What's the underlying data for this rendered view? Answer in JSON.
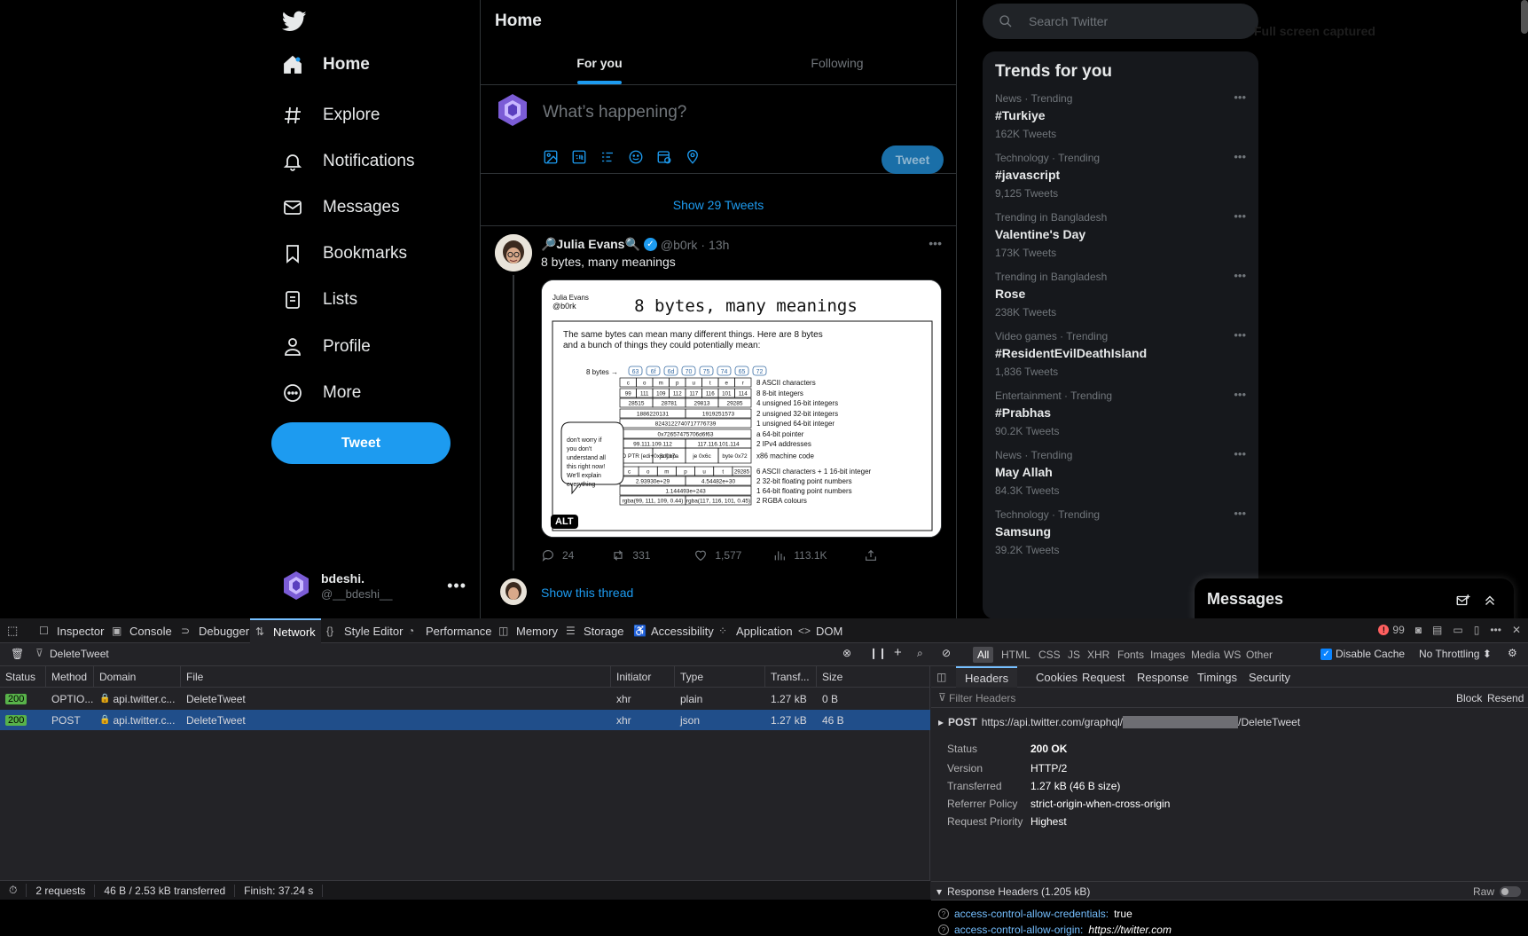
{
  "twitter": {
    "nav": {
      "items": [
        {
          "label": "Home",
          "icon": "home-icon",
          "active": true
        },
        {
          "label": "Explore",
          "icon": "hashtag-icon"
        },
        {
          "label": "Notifications",
          "icon": "bell-icon"
        },
        {
          "label": "Messages",
          "icon": "envelope-icon"
        },
        {
          "label": "Bookmarks",
          "icon": "bookmark-icon"
        },
        {
          "label": "Lists",
          "icon": "list-icon"
        },
        {
          "label": "Profile",
          "icon": "person-icon"
        },
        {
          "label": "More",
          "icon": "more-circle-icon"
        }
      ],
      "tweet_button": "Tweet",
      "account": {
        "display_name": "bdeshi.",
        "handle": "@__bdeshi__"
      }
    },
    "center": {
      "title": "Home",
      "tabs": [
        {
          "label": "For you",
          "active": true
        },
        {
          "label": "Following",
          "active": false
        }
      ],
      "composer": {
        "placeholder": "What’s happening?",
        "tweet_button": "Tweet"
      },
      "show_more": "Show 29 Tweets",
      "post": {
        "author": "🔎Julia Evans🔍",
        "handle": "@b0rk",
        "time": "13h",
        "text": "8 bytes, many meanings",
        "media_alt_badge": "ALT",
        "media": {
          "signature": "Julia Evans @b0rk",
          "title": "8 bytes, many meanings",
          "intro": "The same bytes can mean many different things. Here are 8 bytes and a bunch of things they could potentially mean:",
          "bytes_label": "8 bytes",
          "hex": [
            "63",
            "6f",
            "6d",
            "70",
            "75",
            "74",
            "65",
            "72"
          ],
          "bubble": "don't worry if you don't understand all this right now! We'll explain everything",
          "rows": [
            {
              "cells": [
                "c",
                "o",
                "m",
                "p",
                "u",
                "t",
                "e",
                "r"
              ],
              "desc": "8 ASCII characters"
            },
            {
              "cells": [
                "99",
                "111",
                "109",
                "112",
                "117",
                "116",
                "101",
                "114"
              ],
              "desc": "8 8-bit integers"
            },
            {
              "cells": [
                "28515",
                "28781",
                "29813",
                "29285"
              ],
              "desc": "4 unsigned 16-bit integers"
            },
            {
              "cells": [
                "1886220131",
                "1919251573"
              ],
              "desc": "2 unsigned 32-bit integers"
            },
            {
              "cells": [
                "8243122740717776739"
              ],
              "desc": "1 unsigned 64-bit integer"
            },
            {
              "cells": [
                "0x72657475706d6f63"
              ],
              "desc": "a 64-bit pointer"
            },
            {
              "cells": [
                "99.111.109.112",
                "117.116.101.114"
              ],
              "desc": "2 IPv4 addresses"
            },
            {
              "cells": [
                "arpl WORD PTR [edi+0x6d],bp",
                "jo 0x7a",
                "je 0x6c",
                "byte 0x72"
              ],
              "desc": "x86 machine code"
            },
            {
              "cells": [
                "c",
                "o",
                "m",
                "p",
                "u",
                "t",
                "29285"
              ],
              "desc": "6 ASCII characters + 1 16-bit integer"
            },
            {
              "cells": [
                "2.93930e+29",
                "4.54482e+30"
              ],
              "desc": "2 32-bit floating point numbers"
            },
            {
              "cells": [
                "1.144493e+243"
              ],
              "desc": "1 64-bit floating point numbers"
            },
            {
              "cells": [
                "rgba(99, 111, 109, 0.44)",
                "rgba(117, 116, 101, 0.45)"
              ],
              "desc": "2 RGBA colours"
            }
          ]
        },
        "stats": {
          "replies": "24",
          "retweets": "331",
          "likes": "1,577",
          "views": "113.1K"
        },
        "show_thread": "Show this thread"
      }
    },
    "right": {
      "search_placeholder": "Search Twitter",
      "faded_note": "Full screen captured",
      "trends_title": "Trends for you",
      "trends": [
        {
          "context": "News · Trending",
          "title": "#Turkiye",
          "count": "162K Tweets"
        },
        {
          "context": "Technology · Trending",
          "title": "#javascript",
          "count": "9,125 Tweets"
        },
        {
          "context": "Trending in Bangladesh",
          "title": "Valentine's Day",
          "count": "173K Tweets"
        },
        {
          "context": "Trending in Bangladesh",
          "title": "Rose",
          "count": "238K Tweets"
        },
        {
          "context": "Video games · Trending",
          "title": "#ResidentEvilDeathIsland",
          "count": "1,836 Tweets"
        },
        {
          "context": "Entertainment · Trending",
          "title": "#Prabhas",
          "count": "90.2K Tweets"
        },
        {
          "context": "News · Trending",
          "title": "May Allah",
          "count": "84.3K Tweets"
        },
        {
          "context": "Technology · Trending",
          "title": "Samsung",
          "count": "39.2K Tweets"
        }
      ],
      "messages_dock": "Messages"
    }
  },
  "devtools": {
    "tabs": [
      {
        "label": "Inspector",
        "icon": "inspector-icon"
      },
      {
        "label": "Console",
        "icon": "console-icon"
      },
      {
        "label": "Debugger",
        "icon": "debugger-icon"
      },
      {
        "label": "Network",
        "icon": "network-icon",
        "active": true
      },
      {
        "label": "Style Editor",
        "icon": "braces-icon"
      },
      {
        "label": "Performance",
        "icon": "gauge-icon"
      },
      {
        "label": "Memory",
        "icon": "memory-icon"
      },
      {
        "label": "Storage",
        "icon": "storage-icon"
      },
      {
        "label": "Accessibility",
        "icon": "accessibility-icon"
      },
      {
        "label": "Application",
        "icon": "grid-icon"
      },
      {
        "label": "DOM",
        "icon": "dom-icon"
      }
    ],
    "error_count": "99",
    "filter_url": "DeleteTweet",
    "type_filters": [
      {
        "label": "All",
        "active": true
      },
      {
        "label": "HTML"
      },
      {
        "label": "CSS"
      },
      {
        "label": "JS"
      },
      {
        "label": "XHR"
      },
      {
        "label": "Fonts"
      },
      {
        "label": "Images"
      },
      {
        "label": "Media"
      },
      {
        "label": "WS"
      },
      {
        "label": "Other"
      }
    ],
    "disable_cache": "Disable Cache",
    "throttling": "No Throttling ⬍",
    "columns": [
      "Status",
      "Method",
      "Domain",
      "File",
      "Initiator",
      "Type",
      "Transf...",
      "Size"
    ],
    "requests": [
      {
        "status": "200",
        "method": "OPTIO...",
        "domain": "api.twitter.c...",
        "file": "DeleteTweet",
        "initiator": "xhr",
        "type": "plain",
        "transferred": "1.27 kB",
        "size": "0 B"
      },
      {
        "status": "200",
        "method": "POST",
        "domain": "api.twitter.c...",
        "file": "DeleteTweet",
        "initiator": "xhr",
        "type": "json",
        "transferred": "1.27 kB",
        "size": "46 B",
        "selected": true
      }
    ],
    "status_bar": {
      "requests": "2 requests",
      "transferred": "46 B / 2.53 kB transferred",
      "finish": "Finish: 37.24 s"
    },
    "details": {
      "tabs": [
        "Headers",
        "Cookies",
        "Request",
        "Response",
        "Timings",
        "Security"
      ],
      "filter_placeholder": "Filter Headers",
      "block": "Block",
      "resend": "Resend",
      "method": "POST",
      "url_prefix": "https://api.twitter.com/graphql/",
      "url_suffix": "/DeleteTweet",
      "fields": [
        {
          "key": "Status",
          "value": "200 OK"
        },
        {
          "key": "Version",
          "value": "HTTP/2"
        },
        {
          "key": "Transferred",
          "value": "1.27 kB (46 B size)"
        },
        {
          "key": "Referrer Policy",
          "value": "strict-origin-when-cross-origin"
        },
        {
          "key": "Request Priority",
          "value": "Highest"
        }
      ],
      "response_headers_title": "Response Headers (1.205 kB)",
      "raw": "Raw",
      "response_headers": [
        {
          "name": "access-control-allow-credentials:",
          "value": "true"
        },
        {
          "name": "access-control-allow-origin:",
          "value": "https://twitter.com"
        }
      ]
    }
  },
  "colors": {
    "accent": "#1d9bf0",
    "background": "#000000",
    "devtools_bg": "#232327",
    "selected_row": "#204e8a",
    "status_ok": "#58b34a"
  }
}
